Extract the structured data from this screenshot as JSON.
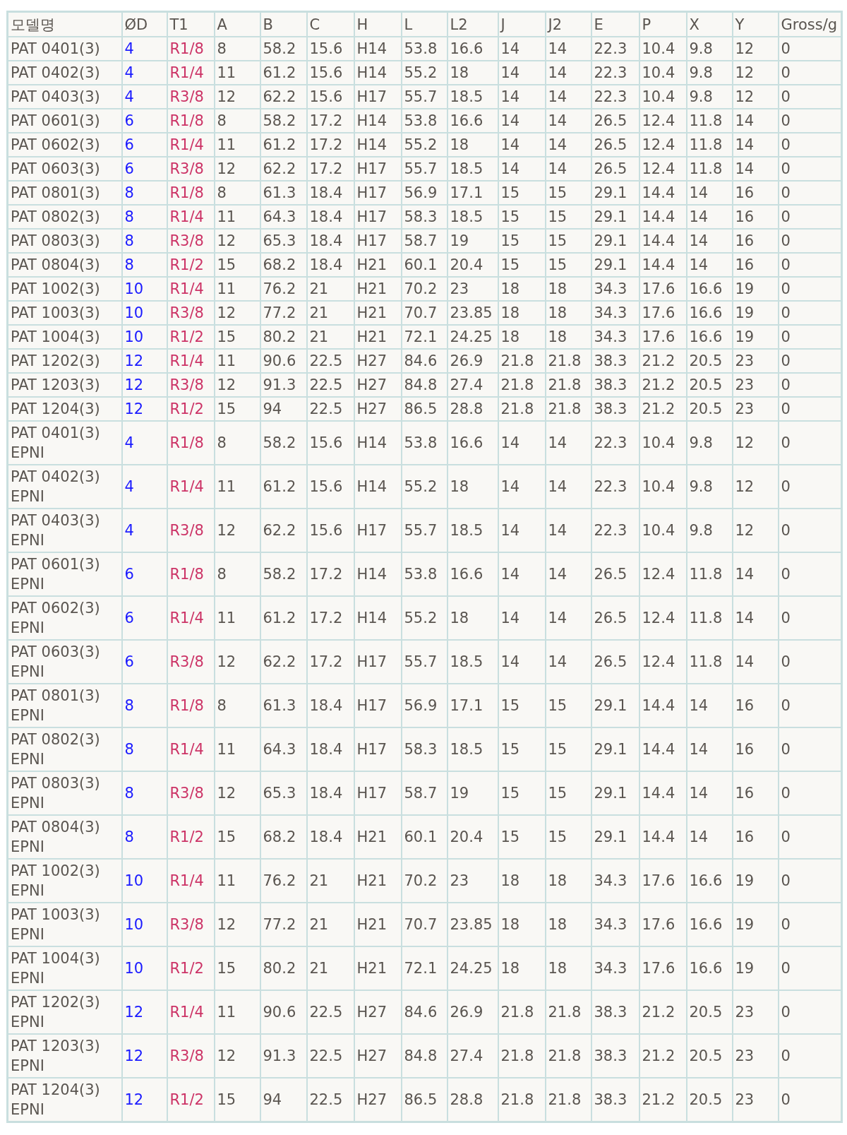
{
  "table": {
    "columns": [
      {
        "label": "모델명"
      },
      {
        "label": "ØD",
        "color": "#1a1aff"
      },
      {
        "label": "T1",
        "color": "#cc3366"
      },
      {
        "label": "A"
      },
      {
        "label": "B"
      },
      {
        "label": "C"
      },
      {
        "label": "H"
      },
      {
        "label": "L"
      },
      {
        "label": "L2"
      },
      {
        "label": "J"
      },
      {
        "label": "J2"
      },
      {
        "label": "E"
      },
      {
        "label": "P"
      },
      {
        "label": "X"
      },
      {
        "label": "Y"
      },
      {
        "label": "Gross/g"
      }
    ],
    "rows": [
      [
        "PAT 0401(3)",
        "4",
        "R1/8",
        "8",
        "58.2",
        "15.6",
        "H14",
        "53.8",
        "16.6",
        "14",
        "14",
        "22.3",
        "10.4",
        "9.8",
        "12",
        "0"
      ],
      [
        "PAT 0402(3)",
        "4",
        "R1/4",
        "11",
        "61.2",
        "15.6",
        "H14",
        "55.2",
        "18",
        "14",
        "14",
        "22.3",
        "10.4",
        "9.8",
        "12",
        "0"
      ],
      [
        "PAT 0403(3)",
        "4",
        "R3/8",
        "12",
        "62.2",
        "15.6",
        "H17",
        "55.7",
        "18.5",
        "14",
        "14",
        "22.3",
        "10.4",
        "9.8",
        "12",
        "0"
      ],
      [
        "PAT 0601(3)",
        "6",
        "R1/8",
        "8",
        "58.2",
        "17.2",
        "H14",
        "53.8",
        "16.6",
        "14",
        "14",
        "26.5",
        "12.4",
        "11.8",
        "14",
        "0"
      ],
      [
        "PAT 0602(3)",
        "6",
        "R1/4",
        "11",
        "61.2",
        "17.2",
        "H14",
        "55.2",
        "18",
        "14",
        "14",
        "26.5",
        "12.4",
        "11.8",
        "14",
        "0"
      ],
      [
        "PAT 0603(3)",
        "6",
        "R3/8",
        "12",
        "62.2",
        "17.2",
        "H17",
        "55.7",
        "18.5",
        "14",
        "14",
        "26.5",
        "12.4",
        "11.8",
        "14",
        "0"
      ],
      [
        "PAT 0801(3)",
        "8",
        "R1/8",
        "8",
        "61.3",
        "18.4",
        "H17",
        "56.9",
        "17.1",
        "15",
        "15",
        "29.1",
        "14.4",
        "14",
        "16",
        "0"
      ],
      [
        "PAT 0802(3)",
        "8",
        "R1/4",
        "11",
        "64.3",
        "18.4",
        "H17",
        "58.3",
        "18.5",
        "15",
        "15",
        "29.1",
        "14.4",
        "14",
        "16",
        "0"
      ],
      [
        "PAT 0803(3)",
        "8",
        "R3/8",
        "12",
        "65.3",
        "18.4",
        "H17",
        "58.7",
        "19",
        "15",
        "15",
        "29.1",
        "14.4",
        "14",
        "16",
        "0"
      ],
      [
        "PAT 0804(3)",
        "8",
        "R1/2",
        "15",
        "68.2",
        "18.4",
        "H21",
        "60.1",
        "20.4",
        "15",
        "15",
        "29.1",
        "14.4",
        "14",
        "16",
        "0"
      ],
      [
        "PAT 1002(3)",
        "10",
        "R1/4",
        "11",
        "76.2",
        "21",
        "H21",
        "70.2",
        "23",
        "18",
        "18",
        "34.3",
        "17.6",
        "16.6",
        "19",
        "0"
      ],
      [
        "PAT 1003(3)",
        "10",
        "R3/8",
        "12",
        "77.2",
        "21",
        "H21",
        "70.7",
        "23.85",
        "18",
        "18",
        "34.3",
        "17.6",
        "16.6",
        "19",
        "0"
      ],
      [
        "PAT 1004(3)",
        "10",
        "R1/2",
        "15",
        "80.2",
        "21",
        "H21",
        "72.1",
        "24.25",
        "18",
        "18",
        "34.3",
        "17.6",
        "16.6",
        "19",
        "0"
      ],
      [
        "PAT 1202(3)",
        "12",
        "R1/4",
        "11",
        "90.6",
        "22.5",
        "H27",
        "84.6",
        "26.9",
        "21.8",
        "21.8",
        "38.3",
        "21.2",
        "20.5",
        "23",
        "0"
      ],
      [
        "PAT 1203(3)",
        "12",
        "R3/8",
        "12",
        "91.3",
        "22.5",
        "H27",
        "84.8",
        "27.4",
        "21.8",
        "21.8",
        "38.3",
        "21.2",
        "20.5",
        "23",
        "0"
      ],
      [
        "PAT 1204(3)",
        "12",
        "R1/2",
        "15",
        "94",
        "22.5",
        "H27",
        "86.5",
        "28.8",
        "21.8",
        "21.8",
        "38.3",
        "21.2",
        "20.5",
        "23",
        "0"
      ],
      [
        "PAT 0401(3) EPNI",
        "4",
        "R1/8",
        "8",
        "58.2",
        "15.6",
        "H14",
        "53.8",
        "16.6",
        "14",
        "14",
        "22.3",
        "10.4",
        "9.8",
        "12",
        "0"
      ],
      [
        "PAT 0402(3) EPNI",
        "4",
        "R1/4",
        "11",
        "61.2",
        "15.6",
        "H14",
        "55.2",
        "18",
        "14",
        "14",
        "22.3",
        "10.4",
        "9.8",
        "12",
        "0"
      ],
      [
        "PAT 0403(3) EPNI",
        "4",
        "R3/8",
        "12",
        "62.2",
        "15.6",
        "H17",
        "55.7",
        "18.5",
        "14",
        "14",
        "22.3",
        "10.4",
        "9.8",
        "12",
        "0"
      ],
      [
        "PAT 0601(3) EPNI",
        "6",
        "R1/8",
        "8",
        "58.2",
        "17.2",
        "H14",
        "53.8",
        "16.6",
        "14",
        "14",
        "26.5",
        "12.4",
        "11.8",
        "14",
        "0"
      ],
      [
        "PAT 0602(3) EPNI",
        "6",
        "R1/4",
        "11",
        "61.2",
        "17.2",
        "H14",
        "55.2",
        "18",
        "14",
        "14",
        "26.5",
        "12.4",
        "11.8",
        "14",
        "0"
      ],
      [
        "PAT 0603(3) EPNI",
        "6",
        "R3/8",
        "12",
        "62.2",
        "17.2",
        "H17",
        "55.7",
        "18.5",
        "14",
        "14",
        "26.5",
        "12.4",
        "11.8",
        "14",
        "0"
      ],
      [
        "PAT 0801(3) EPNI",
        "8",
        "R1/8",
        "8",
        "61.3",
        "18.4",
        "H17",
        "56.9",
        "17.1",
        "15",
        "15",
        "29.1",
        "14.4",
        "14",
        "16",
        "0"
      ],
      [
        "PAT 0802(3) EPNI",
        "8",
        "R1/4",
        "11",
        "64.3",
        "18.4",
        "H17",
        "58.3",
        "18.5",
        "15",
        "15",
        "29.1",
        "14.4",
        "14",
        "16",
        "0"
      ],
      [
        "PAT 0803(3) EPNI",
        "8",
        "R3/8",
        "12",
        "65.3",
        "18.4",
        "H17",
        "58.7",
        "19",
        "15",
        "15",
        "29.1",
        "14.4",
        "14",
        "16",
        "0"
      ],
      [
        "PAT 0804(3) EPNI",
        "8",
        "R1/2",
        "15",
        "68.2",
        "18.4",
        "H21",
        "60.1",
        "20.4",
        "15",
        "15",
        "29.1",
        "14.4",
        "14",
        "16",
        "0"
      ],
      [
        "PAT 1002(3) EPNI",
        "10",
        "R1/4",
        "11",
        "76.2",
        "21",
        "H21",
        "70.2",
        "23",
        "18",
        "18",
        "34.3",
        "17.6",
        "16.6",
        "19",
        "0"
      ],
      [
        "PAT 1003(3) EPNI",
        "10",
        "R3/8",
        "12",
        "77.2",
        "21",
        "H21",
        "70.7",
        "23.85",
        "18",
        "18",
        "34.3",
        "17.6",
        "16.6",
        "19",
        "0"
      ],
      [
        "PAT 1004(3) EPNI",
        "10",
        "R1/2",
        "15",
        "80.2",
        "21",
        "H21",
        "72.1",
        "24.25",
        "18",
        "18",
        "34.3",
        "17.6",
        "16.6",
        "19",
        "0"
      ],
      [
        "PAT 1202(3) EPNI",
        "12",
        "R1/4",
        "11",
        "90.6",
        "22.5",
        "H27",
        "84.6",
        "26.9",
        "21.8",
        "21.8",
        "38.3",
        "21.2",
        "20.5",
        "23",
        "0"
      ],
      [
        "PAT 1203(3) EPNI",
        "12",
        "R3/8",
        "12",
        "91.3",
        "22.5",
        "H27",
        "84.8",
        "27.4",
        "21.8",
        "21.8",
        "38.3",
        "21.2",
        "20.5",
        "23",
        "0"
      ],
      [
        "PAT 1204(3) EPNI",
        "12",
        "R1/2",
        "15",
        "94",
        "22.5",
        "H27",
        "86.5",
        "28.8",
        "21.8",
        "21.8",
        "38.3",
        "21.2",
        "20.5",
        "23",
        "0"
      ]
    ]
  }
}
